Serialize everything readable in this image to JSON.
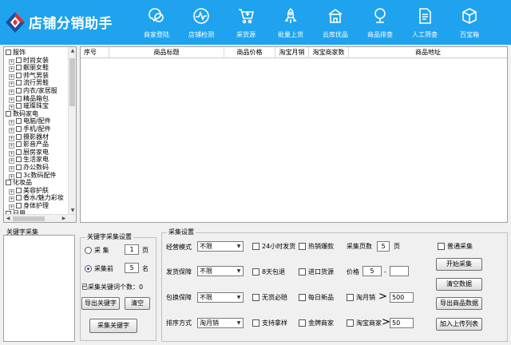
{
  "header": {
    "title": "店铺分销助手",
    "nav": [
      {
        "label": "商家登陆",
        "icon": "user-chat-icon"
      },
      {
        "label": "店铺检测",
        "icon": "pulse-chart-icon"
      },
      {
        "label": "采货源",
        "icon": "cart-add-icon"
      },
      {
        "label": "批量上货",
        "icon": "rocket-icon"
      },
      {
        "label": "云库优品",
        "icon": "cloud-store-icon"
      },
      {
        "label": "商品排查",
        "icon": "search-list-icon"
      },
      {
        "label": "人工筛查",
        "icon": "document-icon"
      },
      {
        "label": "百宝箱",
        "icon": "box-icon"
      }
    ]
  },
  "tree": {
    "items": [
      {
        "label": "服饰",
        "level": 0
      },
      {
        "label": "时尚女装",
        "level": 1
      },
      {
        "label": "靓丽女鞋",
        "level": 1
      },
      {
        "label": "帅气男装",
        "level": 1
      },
      {
        "label": "流行男鞋",
        "level": 1
      },
      {
        "label": "内衣/家居服",
        "level": 1
      },
      {
        "label": "精品箱包",
        "level": 1
      },
      {
        "label": "璀璨珠宝",
        "level": 1
      },
      {
        "label": "数码家电",
        "level": 0
      },
      {
        "label": "电脑/配件",
        "level": 1
      },
      {
        "label": "手机/配件",
        "level": 1
      },
      {
        "label": "摄影器材",
        "level": 1
      },
      {
        "label": "影音产品",
        "level": 1
      },
      {
        "label": "厨房家电",
        "level": 1
      },
      {
        "label": "生活家电",
        "level": 1
      },
      {
        "label": "办公数码",
        "level": 1
      },
      {
        "label": "3c数码配件",
        "level": 1
      },
      {
        "label": "化妆品",
        "level": 0
      },
      {
        "label": "美容护肤",
        "level": 1
      },
      {
        "label": "香水/魅力彩妆",
        "level": 1
      },
      {
        "label": "身体护理",
        "level": 1
      },
      {
        "label": "日用",
        "level": 0
      }
    ]
  },
  "grid": {
    "columns": [
      "序号",
      "商品标题",
      "商品价格",
      "淘宝月销",
      "淘宝商家数",
      "商品地址"
    ]
  },
  "keywords": {
    "label": "关键字采集"
  },
  "kw_settings": {
    "title": "关键字采集设置",
    "opt1_label": "采  集",
    "opt1_value": "1",
    "opt1_unit": "页",
    "opt2_label": "采集前",
    "opt2_value": "5",
    "opt2_unit": "名",
    "count_text": "已采集关键词个数：0",
    "export_btn": "导出关键字",
    "clear_btn": "清空",
    "collect_btn": "采集关键字"
  },
  "collect": {
    "title": "采集设置",
    "rows": [
      {
        "label": "经营模式",
        "value": "不限"
      },
      {
        "label": "发货保障",
        "value": "不限"
      },
      {
        "label": "包换保障",
        "value": "不限"
      },
      {
        "label": "排序方式",
        "value": "淘月销"
      }
    ],
    "checks_a": [
      "24小时发货",
      "8天包退",
      "无货必赔",
      "支持拿样"
    ],
    "checks_b": [
      "热销爆款",
      "进口货源",
      "每日新品",
      "金牌商家"
    ],
    "pages_label": "采集页数",
    "pages_value": "5",
    "pages_unit": "页",
    "price_label": "价格",
    "price_from": "5",
    "price_sep": "-",
    "price_to": "",
    "monthly_label": "淘月销",
    "monthly_op": ">",
    "monthly_value": "500",
    "sellers_label": "淘宝商家",
    "sellers_op": ">",
    "sellers_value": "50",
    "normal_label": "普通采集",
    "btn_start": "开始采集",
    "btn_clear": "清空数据",
    "btn_export": "导出商品数据",
    "btn_upload": "加入上传列表"
  },
  "colors": {
    "header_bg": "#1fa3ee",
    "logo_red": "#e0312d",
    "logo_blue": "#1b4f9c"
  }
}
